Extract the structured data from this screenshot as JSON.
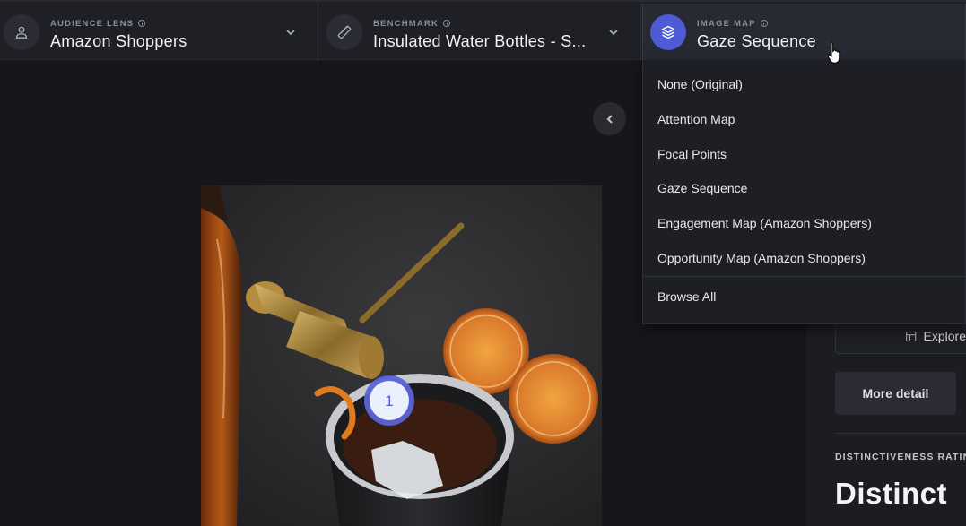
{
  "selectors": {
    "audience": {
      "eyebrow": "AUDIENCE LENS",
      "value": "Amazon Shoppers",
      "icon": "person-icon"
    },
    "benchmark": {
      "eyebrow": "BENCHMARK",
      "value": "Insulated Water Bottles - S...",
      "icon": "ruler-icon"
    },
    "image_map": {
      "eyebrow": "IMAGE MAP",
      "value": "Gaze Sequence",
      "icon": "layers-icon",
      "accent": "#4f5bd5"
    }
  },
  "image_map_options": {
    "items": [
      "None (Original)",
      "Attention Map",
      "Focal Points",
      "Gaze Sequence",
      "Engagement Map (Amazon Shoppers)",
      "Opportunity Map (Amazon Shoppers)"
    ],
    "browse_all": "Browse All"
  },
  "canvas": {
    "gaze_marker": "1"
  },
  "panel": {
    "explore_label": "Explore",
    "more_detail_label": "More detail",
    "rating_label": "DISTINCTIVENESS RATING",
    "rating_value": "Distinct"
  }
}
